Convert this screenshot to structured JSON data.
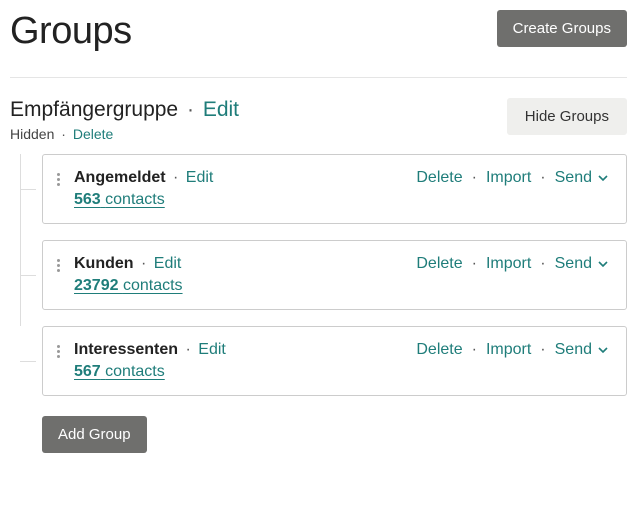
{
  "header": {
    "title": "Groups",
    "create_label": "Create Groups"
  },
  "group": {
    "name": "Empfängergruppe",
    "edit_label": "Edit",
    "hidden_label": "Hidden",
    "delete_label": "Delete",
    "hide_label": "Hide Groups"
  },
  "actions": {
    "edit": "Edit",
    "delete": "Delete",
    "import": "Import",
    "send": "Send"
  },
  "subgroups": [
    {
      "name": "Angemeldet",
      "count": "563",
      "contacts_word": "contacts"
    },
    {
      "name": "Kunden",
      "count": "23792",
      "contacts_word": "contacts"
    },
    {
      "name": "Interessenten",
      "count": "567",
      "contacts_word": "contacts"
    }
  ],
  "add_group_label": "Add Group",
  "sep": "·"
}
